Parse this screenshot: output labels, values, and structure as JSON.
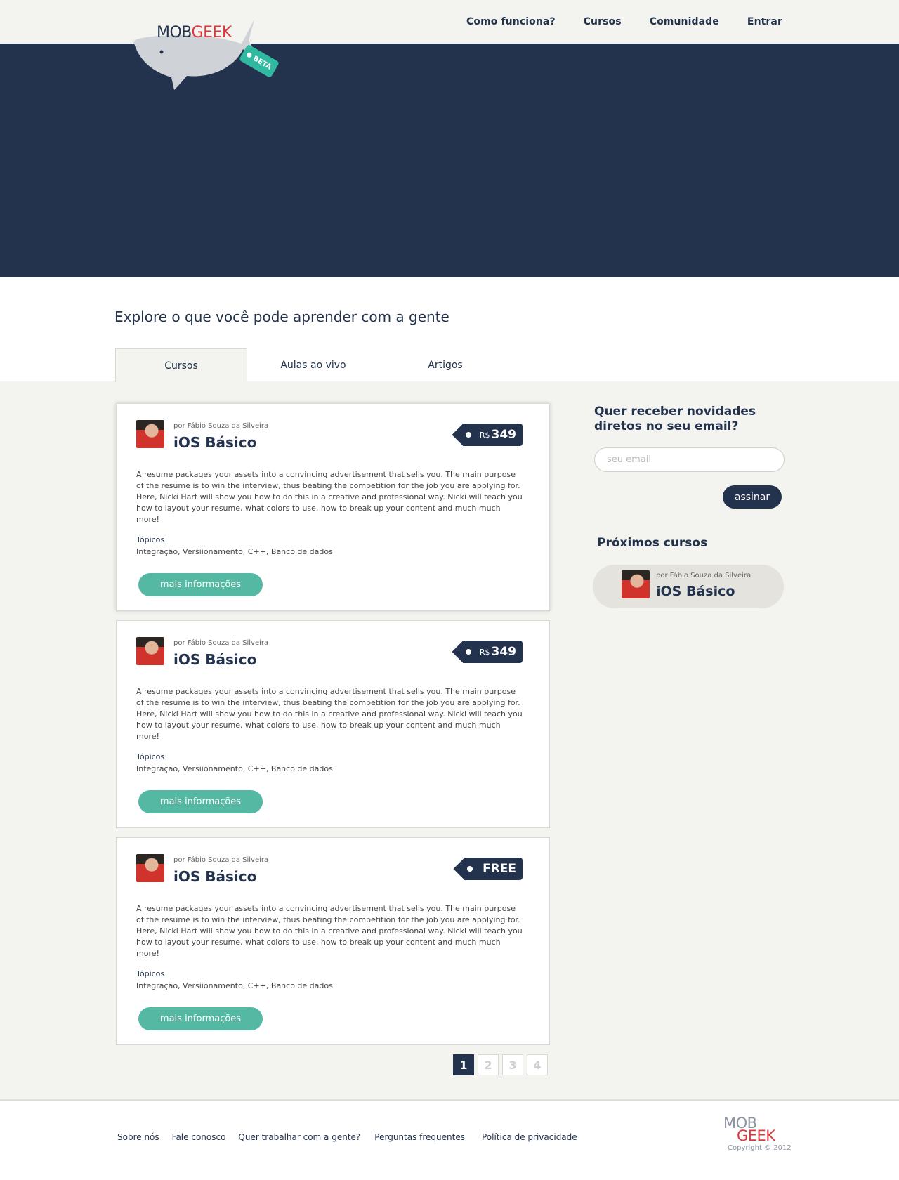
{
  "brand": {
    "mob": "MOB",
    "geek": "GEEK",
    "beta": "BETA"
  },
  "nav": [
    "Como funciona?",
    "Cursos",
    "Comunidade",
    "Entrar"
  ],
  "explore": {
    "title": "Explore o que você pode aprender com a gente",
    "tabs": [
      "Cursos",
      "Aulas ao vivo",
      "Artigos"
    ],
    "active_tab": "Cursos"
  },
  "courses": [
    {
      "author": "por Fábio Souza da Silveira",
      "title": "iOS Básico",
      "price_currency": "R$",
      "price_value": "349",
      "description": "A resume packages your assets into a convincing advertisement that sells you. The main purpose of the resume is to win the interview, thus beating the competition for the job you are applying for. Here, Nicki Hart will show you how to do this in a creative and professional way. Nicki will teach you how to layout your resume, what colors to use, how to break up your content and much much more!",
      "topics_label": "Tópicos",
      "topics": "Integração, Versiionamento, C++, Banco de dados",
      "button": "mais informações"
    },
    {
      "author": "por Fábio Souza da Silveira",
      "title": "iOS Básico",
      "price_currency": "R$",
      "price_value": "349",
      "description": "A resume packages your assets into a convincing advertisement that sells you. The main purpose of the resume is to win the interview, thus beating the competition for the job you are applying for. Here, Nicki Hart will show you how to do this in a creative and professional way. Nicki will teach you how to layout your resume, what colors to use, how to break up your content and much much more!",
      "topics_label": "Tópicos",
      "topics": "Integração, Versiionamento, C++, Banco de dados",
      "button": "mais informações"
    },
    {
      "author": "por Fábio Souza da Silveira",
      "title": "iOS Básico",
      "price_currency": "",
      "price_value": "FREE",
      "description": "A resume packages your assets into a convincing advertisement that sells you. The main purpose of the resume is to win the interview, thus beating the competition for the job you are applying for. Here, Nicki Hart will show you how to do this in a creative and professional way. Nicki will teach you how to layout your resume, what colors to use, how to break up your content and much much more!",
      "topics_label": "Tópicos",
      "topics": "Integração, Versiionamento, C++, Banco de dados",
      "button": "mais informações"
    }
  ],
  "newsletter": {
    "title": "Quer receber novidades diretos no seu email?",
    "placeholder": "seu email",
    "button": "assinar"
  },
  "upcoming": {
    "title": "Próximos cursos",
    "author": "por Fábio Souza da Silveira",
    "course": "iOS Básico"
  },
  "pagination": {
    "pages": [
      "1",
      "2",
      "3",
      "4"
    ],
    "current": "1"
  },
  "footer": {
    "links": [
      "Sobre nós",
      "Fale conosco",
      "Quer trabalhar com a gente?",
      "Perguntas frequentes",
      "Política de privacidade"
    ],
    "logo_mob": "MOB",
    "logo_geek": "GEEK",
    "copyright": "Copyright © 2012"
  },
  "colors": {
    "navy": "#23324d",
    "teal": "#55b8a2",
    "beta_teal": "#2fb9a1",
    "brand_red": "#e0373b",
    "background": "#f3f3ef"
  },
  "icons": [
    "whale-logo-icon",
    "price-tag-icon",
    "author-avatar-icon"
  ]
}
